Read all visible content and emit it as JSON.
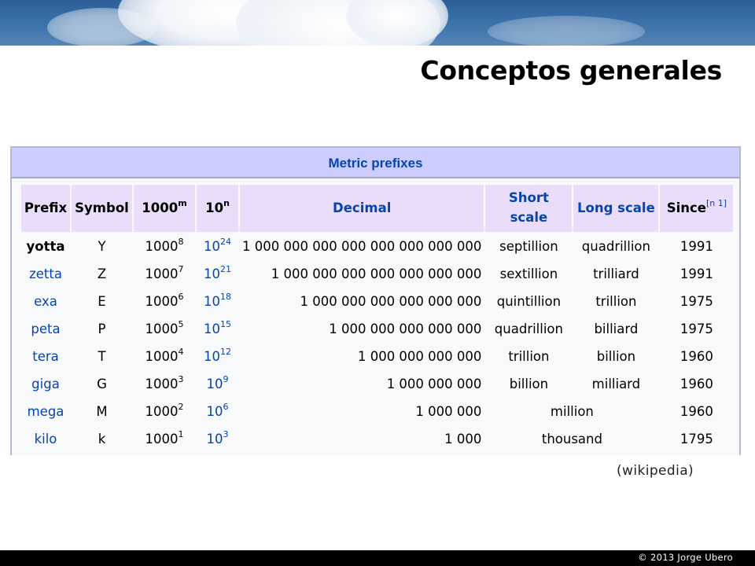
{
  "slide": {
    "title": "Conceptos generales",
    "source": "(wikipedia)",
    "copyright": "© 2013 Jorge Ubero"
  },
  "table": {
    "caption": "Metric prefixes",
    "headers": {
      "prefix": "Prefix",
      "symbol": "Symbol",
      "thousand_base": "1000",
      "thousand_exp": "m",
      "ten_base": "10",
      "ten_exp": "n",
      "decimal": "Decimal",
      "short_scale_1": "Short",
      "short_scale_2": "scale",
      "long_scale": "Long scale",
      "since": "Since",
      "since_note": "[n 1]"
    },
    "rows": [
      {
        "prefix": "yotta",
        "symbol": "Y",
        "tb": "1000",
        "te": "8",
        "nb": "10",
        "ne": "24",
        "decimal": "1 000 000 000 000 000 000 000 000",
        "short": "septillion",
        "long": "quadrillion",
        "merged": "",
        "since": "1991"
      },
      {
        "prefix": "zetta",
        "symbol": "Z",
        "tb": "1000",
        "te": "7",
        "nb": "10",
        "ne": "21",
        "decimal": "1 000 000 000 000 000 000 000",
        "short": "sextillion",
        "long": "trilliard",
        "merged": "",
        "since": "1991"
      },
      {
        "prefix": "exa",
        "symbol": "E",
        "tb": "1000",
        "te": "6",
        "nb": "10",
        "ne": "18",
        "decimal": "1 000 000 000 000 000 000",
        "short": "quintillion",
        "long": "trillion",
        "merged": "",
        "since": "1975"
      },
      {
        "prefix": "peta",
        "symbol": "P",
        "tb": "1000",
        "te": "5",
        "nb": "10",
        "ne": "15",
        "decimal": "1 000 000 000 000 000",
        "short": "quadrillion",
        "long": "billiard",
        "merged": "",
        "since": "1975"
      },
      {
        "prefix": "tera",
        "symbol": "T",
        "tb": "1000",
        "te": "4",
        "nb": "10",
        "ne": "12",
        "decimal": "1 000 000 000 000",
        "short": "trillion",
        "long": "billion",
        "merged": "",
        "since": "1960"
      },
      {
        "prefix": "giga",
        "symbol": "G",
        "tb": "1000",
        "te": "3",
        "nb": "10",
        "ne": "9",
        "decimal": "1 000 000 000",
        "short": "billion",
        "long": "milliard",
        "merged": "",
        "since": "1960"
      },
      {
        "prefix": "mega",
        "symbol": "M",
        "tb": "1000",
        "te": "2",
        "nb": "10",
        "ne": "6",
        "decimal": "1 000 000",
        "short": "",
        "long": "",
        "merged": "million",
        "since": "1960"
      },
      {
        "prefix": "kilo",
        "symbol": "k",
        "tb": "1000",
        "te": "1",
        "nb": "10",
        "ne": "3",
        "decimal": "1 000",
        "short": "",
        "long": "",
        "merged": "thousand",
        "since": "1795"
      }
    ]
  },
  "colors": {
    "link": "#0645ad",
    "caption_bg": "#ccccff",
    "header_bg": "#eaddfa"
  }
}
